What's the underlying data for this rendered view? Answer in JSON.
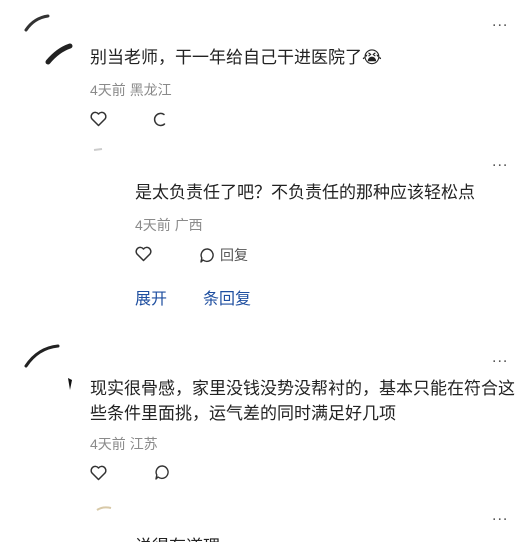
{
  "comments": [
    {
      "text": "别当老师，干一年给自己干进医院了",
      "emoji": "😭",
      "time": "4天前",
      "location": "黑龙江",
      "likes": "",
      "reply_label": ""
    },
    {
      "text": "是太负责任了吧？不负责任的那种应该轻松点",
      "time": "4天前",
      "location": "广西",
      "likes": "",
      "reply_label": "回复",
      "expand_label": "展开",
      "extra_label": "条回复"
    },
    {
      "text": "现实很骨感，家里没钱没势没帮衬的，基本只能在符合这些条件里面挑，运气差的同时满足好几项",
      "time": "4天前",
      "location": "江苏",
      "likes": "",
      "reply_label": ""
    },
    {
      "text": "说得有道理",
      "reply_label": ""
    }
  ],
  "more_label": "..."
}
